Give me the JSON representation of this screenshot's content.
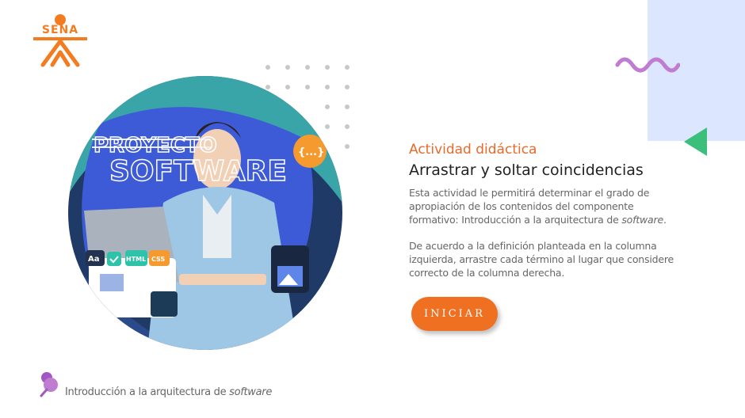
{
  "logo": {
    "text": "SENA",
    "color": "#f47c20"
  },
  "colors": {
    "accent_orange": "#f07021",
    "panel_blue": "#dde6ff",
    "wave_purple": "#c07cd1",
    "triangle_green": "#3dbf7c"
  },
  "hero": {
    "project_word_1": "PROYECTO",
    "project_word_2": "SOFTWARE",
    "badge_symbol": "{...}",
    "chip_aa": "Aa",
    "chip_html": "HTML",
    "chip_css": "CSS"
  },
  "content": {
    "subtitle": "Actividad didáctica",
    "title": "Arrastrar y soltar coincidencias",
    "para1_main": "Esta actividad le permitirá determinar el grado de apropiación de los contenidos del componente formativo: Introducción a la arquitectura de ",
    "para1_em": "software",
    "para1_end": ".",
    "para2": "De acuerdo a la definición planteada en la columna izquierda, arrastre cada término al lugar que considere correcto de la columna derecha."
  },
  "button": {
    "label": "INICIAR"
  },
  "footer": {
    "text_main": "Introducción a la arquitectura de ",
    "text_em": "software",
    "icon": "pin-icon"
  }
}
